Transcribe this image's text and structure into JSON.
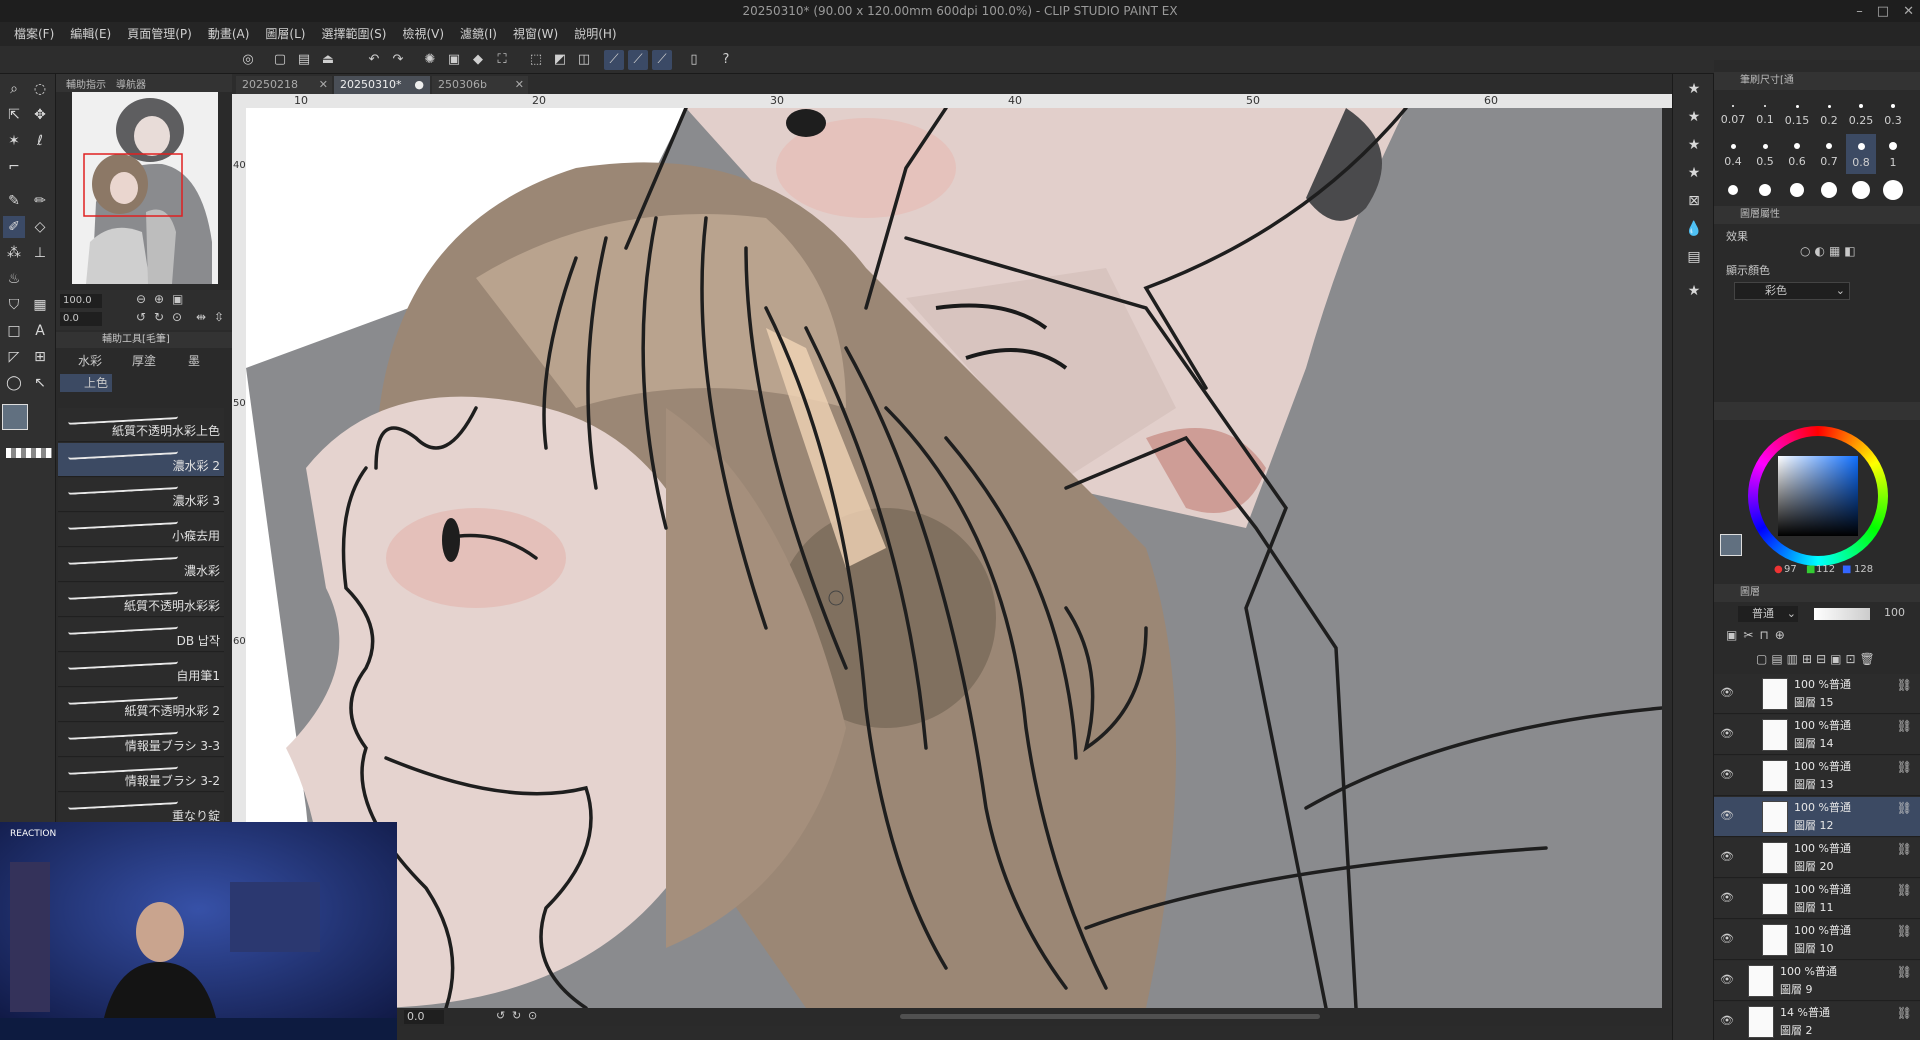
{
  "window": {
    "title": "20250310* (90.00 x 120.00mm 600dpi 100.0%) - CLIP STUDIO PAINT EX",
    "controls": [
      "–",
      "□",
      "✕"
    ]
  },
  "menu": [
    "檔案(F)",
    "編輯(E)",
    "頁面管理(P)",
    "動畫(A)",
    "圖層(L)",
    "選擇範圍(S)",
    "檢視(V)",
    "濾鏡(I)",
    "視窗(W)",
    "說明(H)"
  ],
  "navigator": {
    "tabs": [
      "輔助指示",
      "導航器"
    ],
    "zoom": "100.0",
    "rotation": "0.0"
  },
  "subtool": {
    "header": "輔助工具[毛筆]",
    "groups": [
      "水彩",
      "厚塗",
      "墨"
    ],
    "active_group": "上色",
    "brushes": [
      "紙質不透明水彩上色",
      "濃水彩 2",
      "濃水彩 3",
      "小瘊去用",
      "濃水彩",
      "紙質不透明水彩彩",
      "DB 납작",
      "自用筆1",
      "紙質不透明水彩 2",
      "情報量ブラシ 3-3",
      "情報量ブラシ 3-2",
      "重なり錠"
    ],
    "selected_index": 1
  },
  "documents": {
    "tabs": [
      "20250218",
      "20250310*",
      "250306b"
    ],
    "active_index": 1
  },
  "ruler": {
    "top_marks": [
      "10",
      "20",
      "30",
      "40",
      "50",
      "60"
    ],
    "left_marks": [
      "40",
      "50",
      "60"
    ]
  },
  "canvas": {
    "rotation_value": "0.0"
  },
  "brush_size": {
    "header": "筆刷尺寸[通",
    "sizes": [
      "0.07",
      "0.1",
      "0.15",
      "0.2",
      "0.25",
      "0.3",
      "0.4",
      "0.5",
      "0.6",
      "0.7",
      "0.8",
      "1"
    ],
    "selected": "0.8"
  },
  "layer_property": {
    "header": "圖層屬性",
    "effect_label": "效果",
    "display_color_label": "顯示顏色",
    "display_color_value": "彩色"
  },
  "color": {
    "r": "97",
    "g": "112",
    "b": "128",
    "main_hex": "#617080"
  },
  "layers": {
    "header": "圖層",
    "blend_mode": "普通",
    "opacity": "100",
    "items": [
      {
        "mode": "100 %普通",
        "name": "圖層 15"
      },
      {
        "mode": "100 %普通",
        "name": "圖層 14"
      },
      {
        "mode": "100 %普通",
        "name": "圖層 13"
      },
      {
        "mode": "100 %普通",
        "name": "圖層 12"
      },
      {
        "mode": "100 %普通",
        "name": "圖層 20"
      },
      {
        "mode": "100 %普通",
        "name": "圖層 11"
      },
      {
        "mode": "100 %普通",
        "name": "圖層 10"
      },
      {
        "mode": "100 %普通",
        "name": "圖層 9"
      },
      {
        "mode": "14 %普通",
        "name": "圖層 2"
      }
    ],
    "selected_index": 3
  },
  "webcam": {
    "badge": "REACTION"
  }
}
